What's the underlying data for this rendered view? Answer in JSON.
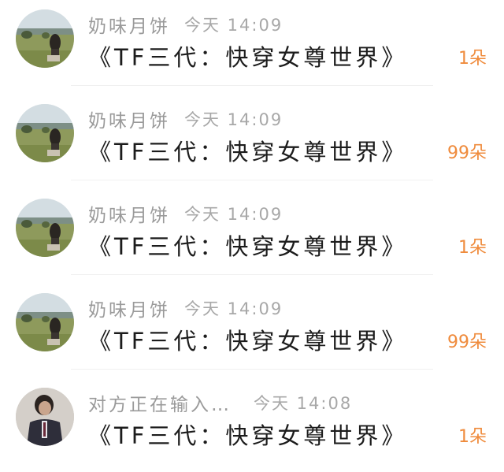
{
  "chats": [
    {
      "name": "奶味月饼",
      "time": "今天 14:09",
      "message": "《TF三代：快穿女尊世界》",
      "count": "1朵",
      "avatar": "landscape-avatar"
    },
    {
      "name": "奶味月饼",
      "time": "今天 14:09",
      "message": "《TF三代：快穿女尊世界》",
      "count": "99朵",
      "avatar": "landscape-avatar"
    },
    {
      "name": "奶味月饼",
      "time": "今天 14:09",
      "message": "《TF三代：快穿女尊世界》",
      "count": "1朵",
      "avatar": "landscape-avatar"
    },
    {
      "name": "奶味月饼",
      "time": "今天 14:09",
      "message": "《TF三代：快穿女尊世界》",
      "count": "99朵",
      "avatar": "landscape-avatar"
    },
    {
      "name": "对方正在输入…",
      "time": "今天 14:08",
      "message": "《TF三代：快穿女尊世界》",
      "count": "1朵",
      "avatar": "person-avatar"
    }
  ],
  "colors": {
    "name": "#9a9a9a",
    "time": "#a8a8a8",
    "message": "#1c1c1c",
    "count": "#ef8b3c"
  }
}
